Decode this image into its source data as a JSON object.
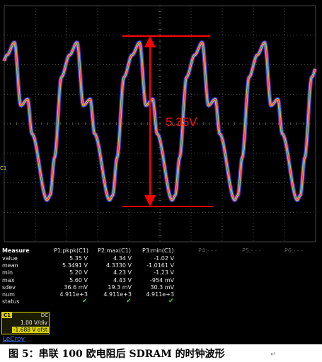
{
  "figure": {
    "amplitude_annotation": "5.35V",
    "channel_marker": "C1",
    "vertical_divisions": 8,
    "horizontal_divisions": 10,
    "clock_cycles_visible": 5,
    "colors": {
      "annotation": "#ff0000",
      "grid": "#5a5a5a",
      "trace_core": "#ff4030",
      "trace_mid": "#f0e020",
      "trace_halo": "#4060ff",
      "trace_outer": "#8020e0",
      "trace_edge": "#30e0c0"
    }
  },
  "measure": {
    "header": "Measure",
    "row_labels": [
      "value",
      "mean",
      "min",
      "max",
      "sdev",
      "num",
      "status"
    ],
    "params": [
      {
        "name": "P1:pkpk(C1)",
        "value": "5.35 V",
        "mean": "5.3491 V",
        "min": "5.20 V",
        "max": "5.60 V",
        "sdev": "36.6 mV",
        "num": "4.911e+3",
        "status": "✔"
      },
      {
        "name": "P2:max(C1)",
        "value": "4.34 V",
        "mean": "4.3330 V",
        "min": "4.23 V",
        "max": "4.43 V",
        "sdev": "19.3 mV",
        "num": "4.911e+3",
        "status": "✔"
      },
      {
        "name": "P3:min(C1)",
        "value": "-1.02 V",
        "mean": "-1.0161 V",
        "min": "-1.23 V",
        "max": "-954 mV",
        "sdev": "30.3 mV",
        "num": "4.911e+3",
        "status": "✔"
      }
    ],
    "inactive": [
      "P4:- - -",
      "P5:- - -",
      "P6:- - -"
    ]
  },
  "channel": {
    "tag": "C1",
    "coupling": "DC",
    "vdiv": "1.00 V/div",
    "offset": "-1.688 V ofst"
  },
  "brand": "LeCroy",
  "caption": "图 5：串联 100 欧电阻后 SDRAM 的时钟波形",
  "caption_mark": "↵"
}
